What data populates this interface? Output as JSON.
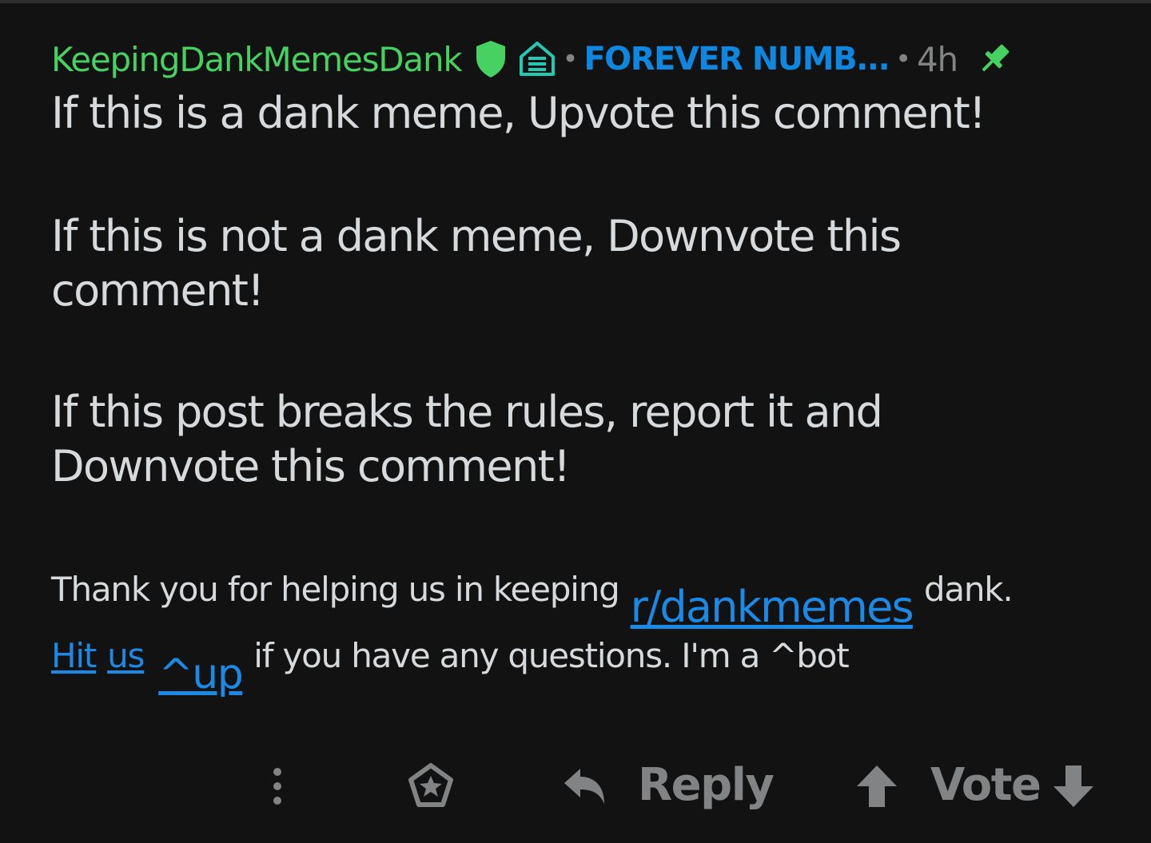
{
  "comment": {
    "author": "KeepingDankMemesDank",
    "separator": "•",
    "flair_text": "FOREVER NUMB...",
    "timestamp": "4h",
    "icons": {
      "mod": "shield-icon",
      "flair": "flair-hand-icon",
      "pinned": "pin-icon"
    },
    "body": {
      "p1": "If this is a dank meme, Upvote this comment!",
      "p2": "If this is not a dank meme, Downvote this comment!",
      "p3": "If this post breaks the rules, report it and Downvote this comment!",
      "footer": {
        "line1_prefix": "Thank you for helping us in keeping",
        "subreddit_link": "r/dankmemes",
        "line1_suffix": "dank.",
        "hit_link": "Hit",
        "us_link": "us",
        "up_link": "^up",
        "line2_suffix": "if you have any questions.  I'm a ^bot"
      }
    }
  },
  "toolbar": {
    "more_icon": "more-vertical-icon",
    "award_icon": "award-icon",
    "reply_icon": "reply-arrow-icon",
    "reply_label": "Reply",
    "upvote_icon": "upvote-arrow-icon",
    "vote_label": "Vote",
    "downvote_icon": "downvote-arrow-icon"
  },
  "colors": {
    "background": "#121212",
    "username": "#46d160",
    "flair": "#0d87e0",
    "link": "#1a8ae6",
    "text": "#d7dadc",
    "muted": "#818384",
    "flair_icon": "#24c9b3"
  }
}
